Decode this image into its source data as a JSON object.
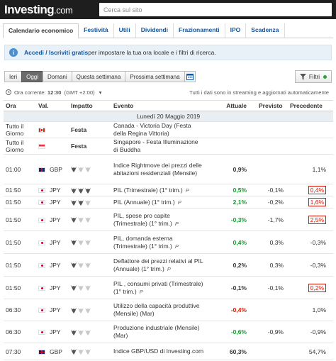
{
  "header": {
    "logo_main": "Investing",
    "logo_suffix": ".com",
    "search_placeholder": "Cerca sul sito"
  },
  "tabs": [
    "Calendario economico",
    "Festività",
    "Utili",
    "Dividendi",
    "Frazionamenti",
    "IPO",
    "Scadenza"
  ],
  "notice": {
    "link": "Accedi / Iscriviti gratis",
    "text": " per impostare la tua ora locale e i filtri di ricerca."
  },
  "periods": [
    "Ieri",
    "Oggi",
    "Domani",
    "Questa settimana",
    "Prossima settimana"
  ],
  "filter_label": "Filtri",
  "current_time": {
    "label": "Ora corrente:",
    "value": "12:30",
    "tz": "(GMT +2:00)"
  },
  "streaming_note": "Tutti i dati sono in streaming e aggiornati automaticamente",
  "columns": [
    "Ora",
    "Val.",
    "Impatto",
    "Evento",
    "Attuale",
    "Previsto",
    "Precedente"
  ],
  "date_row": "Lunedì 20 Maggio 2019",
  "rows": [
    {
      "time": "Tutto il Giorno",
      "flag": "ca",
      "cur": "",
      "impact": "Festa",
      "event": "Canada - Victoria Day (Festa della Regina Vittoria)",
      "pre": "",
      "actual": "",
      "forecast": "",
      "previous": "",
      "actual_color": "",
      "previous_color": ""
    },
    {
      "time": "Tutto il Giorno",
      "flag": "sg",
      "cur": "",
      "impact": "Festa",
      "event": "Singapore - Festa Illuminazione di Buddha",
      "pre": "",
      "actual": "",
      "forecast": "",
      "previous": "",
      "actual_color": "",
      "previous_color": ""
    },
    {
      "time": "01:00",
      "flag": "uk",
      "cur": "GBP",
      "impact": 1,
      "event": "Indice Rightmove dei prezzi delle abitazioni residenziali (Mensile)",
      "pre": "",
      "actual": "0,9%",
      "forecast": "",
      "previous": "1,1%",
      "actual_color": "",
      "previous_color": ""
    },
    {
      "time": "01:50",
      "flag": "jp",
      "cur": "JPY",
      "impact": 3,
      "event": "PIL (Trimestrale) (1° trim.)",
      "pre": "P",
      "actual": "0,5%",
      "forecast": "-0,1%",
      "previous": "0,4%",
      "actual_color": "green",
      "previous_color": "red"
    },
    {
      "time": "01:50",
      "flag": "jp",
      "cur": "JPY",
      "impact": 2,
      "event": "PIL (Annuale) (1° trim.)",
      "pre": "P",
      "actual": "2,1%",
      "forecast": "-0,2%",
      "previous": "1,6%",
      "actual_color": "green",
      "previous_color": "red"
    },
    {
      "time": "01:50",
      "flag": "jp",
      "cur": "JPY",
      "impact": 1,
      "event": "PIL, spese pro capite (Trimestrale) (1° trim.)",
      "pre": "P",
      "actual": "-0,3%",
      "forecast": "-1,7%",
      "previous": "2,5%",
      "actual_color": "green",
      "previous_color": "red"
    },
    {
      "time": "01:50",
      "flag": "jp",
      "cur": "JPY",
      "impact": 1,
      "event": "PIL, domanda esterna (Trimestrale) (1° trim.)",
      "pre": "P",
      "actual": "0,4%",
      "forecast": "0,3%",
      "previous": "-0,3%",
      "actual_color": "green",
      "previous_color": ""
    },
    {
      "time": "01:50",
      "flag": "jp",
      "cur": "JPY",
      "impact": 1,
      "event": "Deflattore dei prezzi relativi al PIL (Annuale) (1° trim.)",
      "pre": "P",
      "actual": "0,2%",
      "forecast": "0,3%",
      "previous": "-0,3%",
      "actual_color": "",
      "previous_color": ""
    },
    {
      "time": "01:50",
      "flag": "jp",
      "cur": "JPY",
      "impact": 1,
      "event": "PIL , consumi privati (Trimestrale) (1° trim.)",
      "pre": "P",
      "actual": "-0,1%",
      "forecast": "-0,1%",
      "previous": "0,2%",
      "actual_color": "",
      "previous_color": "red"
    },
    {
      "time": "06:30",
      "flag": "jp",
      "cur": "JPY",
      "impact": 1,
      "event": "Utilizzo della capacità produttive (Mensile) (Mar)",
      "pre": "",
      "actual": "-0,4%",
      "forecast": "",
      "previous": "1,0%",
      "actual_color": "red",
      "previous_color": ""
    },
    {
      "time": "06:30",
      "flag": "jp",
      "cur": "JPY",
      "impact": 1,
      "event": "Produzione industriale (Mensile) (Mar)",
      "pre": "",
      "actual": "-0,6%",
      "forecast": "-0,9%",
      "previous": "-0,9%",
      "actual_color": "green",
      "previous_color": ""
    },
    {
      "time": "07:30",
      "flag": "uk",
      "cur": "GBP",
      "impact": 1,
      "event": "Indice GBP/USD di Investing.com",
      "pre": "",
      "actual": "60,3%",
      "forecast": "",
      "previous": "54,7%",
      "actual_color": "",
      "previous_color": ""
    }
  ]
}
